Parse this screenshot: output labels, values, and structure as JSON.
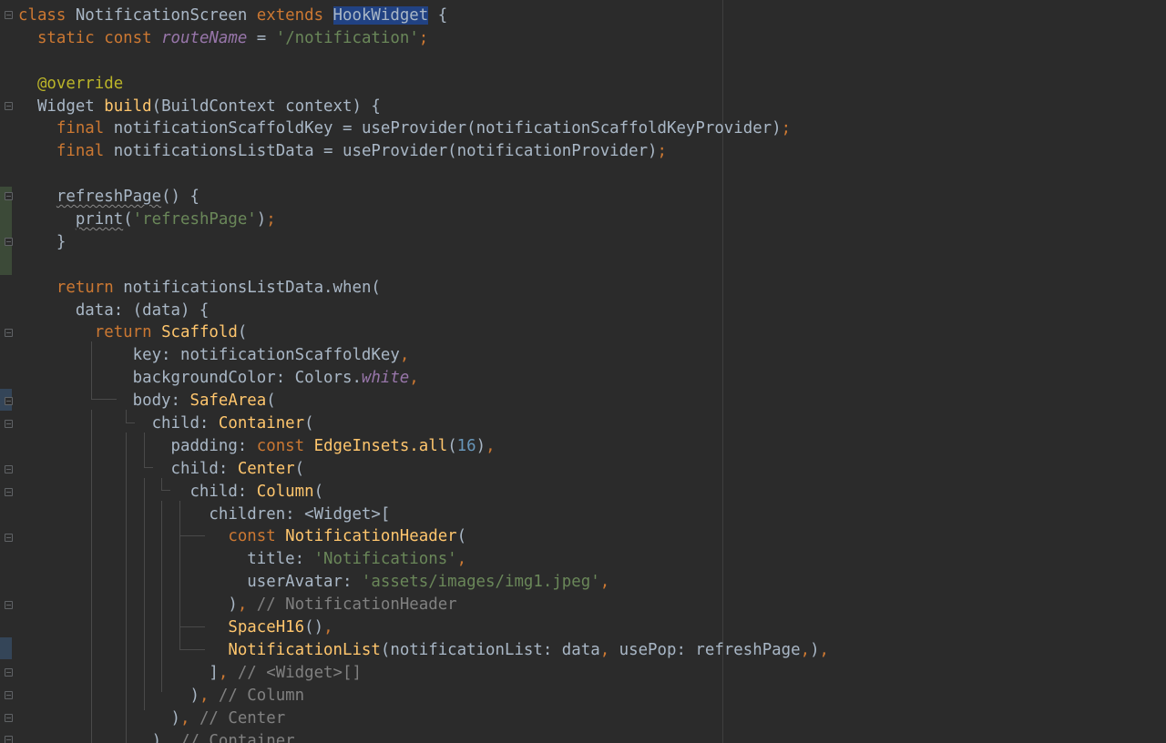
{
  "editor": {
    "language": "dart",
    "lines": [
      [
        [
          "kw",
          "class "
        ],
        [
          "p",
          "NotificationScreen "
        ],
        [
          "kw",
          "extends "
        ],
        [
          "hl",
          "HookWidget"
        ],
        [
          "p",
          " {"
        ]
      ],
      [
        [
          "p",
          "  "
        ],
        [
          "kw",
          "static const "
        ],
        [
          "ital",
          "routeName"
        ],
        [
          "p",
          " = "
        ],
        [
          "str",
          "'/notification'"
        ],
        [
          "kw",
          ";"
        ]
      ],
      [
        [
          "p",
          ""
        ]
      ],
      [
        [
          "p",
          "  "
        ],
        [
          "ann",
          "@override"
        ]
      ],
      [
        [
          "p",
          "  Widget "
        ],
        [
          "fn",
          "build"
        ],
        [
          "p",
          "(BuildContext context) {"
        ]
      ],
      [
        [
          "p",
          "    "
        ],
        [
          "kw",
          "final "
        ],
        [
          "p",
          "notificationScaffoldKey = useProvider(notificationScaffoldKeyProvider)"
        ],
        [
          "kw",
          ";"
        ]
      ],
      [
        [
          "p",
          "    "
        ],
        [
          "kw",
          "final "
        ],
        [
          "p",
          "notificationsListData = useProvider(notificationProvider)"
        ],
        [
          "kw",
          ";"
        ]
      ],
      [
        [
          "p",
          ""
        ]
      ],
      [
        [
          "p",
          "    "
        ],
        [
          "squig",
          "refreshPage"
        ],
        [
          "p",
          "() {"
        ]
      ],
      [
        [
          "p",
          "      "
        ],
        [
          "squig",
          "print"
        ],
        [
          "p",
          "("
        ],
        [
          "str",
          "'refreshPage'"
        ],
        [
          "p",
          ")"
        ],
        [
          "kw",
          ";"
        ]
      ],
      [
        [
          "p",
          "    }"
        ]
      ],
      [
        [
          "p",
          ""
        ]
      ],
      [
        [
          "p",
          "    "
        ],
        [
          "kw",
          "return "
        ],
        [
          "p",
          "notificationsListData.when("
        ]
      ],
      [
        [
          "p",
          "      data: (data) {"
        ]
      ],
      [
        [
          "p",
          "        "
        ],
        [
          "kw",
          "return "
        ],
        [
          "fn",
          "Scaffold"
        ],
        [
          "p",
          "("
        ]
      ],
      [
        [
          "p",
          "            key: notificationScaffoldKey"
        ],
        [
          "kw",
          ","
        ]
      ],
      [
        [
          "p",
          "            backgroundColor: Colors."
        ],
        [
          "ital",
          "white"
        ],
        [
          "kw",
          ","
        ]
      ],
      [
        [
          "p",
          "            body: "
        ],
        [
          "fn",
          "SafeArea"
        ],
        [
          "p",
          "("
        ]
      ],
      [
        [
          "p",
          "              child: "
        ],
        [
          "fn",
          "Container"
        ],
        [
          "p",
          "("
        ]
      ],
      [
        [
          "p",
          "                padding: "
        ],
        [
          "kw",
          "const "
        ],
        [
          "fn",
          "EdgeInsets.all"
        ],
        [
          "p",
          "("
        ],
        [
          "num",
          "16"
        ],
        [
          "p",
          ")"
        ],
        [
          "kw",
          ","
        ]
      ],
      [
        [
          "p",
          "                child: "
        ],
        [
          "fn",
          "Center"
        ],
        [
          "p",
          "("
        ]
      ],
      [
        [
          "p",
          "                  child: "
        ],
        [
          "fn",
          "Column"
        ],
        [
          "p",
          "("
        ]
      ],
      [
        [
          "p",
          "                    children: <Widget>["
        ]
      ],
      [
        [
          "p",
          "                      "
        ],
        [
          "kw",
          "const "
        ],
        [
          "fn",
          "NotificationHeader"
        ],
        [
          "p",
          "("
        ]
      ],
      [
        [
          "p",
          "                        title: "
        ],
        [
          "str",
          "'Notifications'"
        ],
        [
          "kw",
          ","
        ]
      ],
      [
        [
          "p",
          "                        userAvatar: "
        ],
        [
          "str",
          "'assets/images/img1.jpeg'"
        ],
        [
          "kw",
          ","
        ]
      ],
      [
        [
          "p",
          "                      )"
        ],
        [
          "kw",
          ", "
        ],
        [
          "cmt",
          "// NotificationHeader"
        ]
      ],
      [
        [
          "p",
          "                      "
        ],
        [
          "fn",
          "SpaceH16"
        ],
        [
          "p",
          "()"
        ],
        [
          "kw",
          ","
        ]
      ],
      [
        [
          "p",
          "                      "
        ],
        [
          "fn",
          "NotificationList"
        ],
        [
          "p",
          "(notificationList: data"
        ],
        [
          "kw",
          ", "
        ],
        [
          "p",
          "usePop: refreshPage"
        ],
        [
          "kw",
          ","
        ],
        [
          "p",
          ")"
        ],
        [
          "kw",
          ","
        ]
      ],
      [
        [
          "p",
          "                    ]"
        ],
        [
          "kw",
          ", "
        ],
        [
          "cmt",
          "// <Widget>[]"
        ]
      ],
      [
        [
          "p",
          "                  )"
        ],
        [
          "kw",
          ", "
        ],
        [
          "cmt",
          "// Column"
        ]
      ],
      [
        [
          "p",
          "                )"
        ],
        [
          "kw",
          ", "
        ],
        [
          "cmt",
          "// Center"
        ]
      ],
      [
        [
          "p",
          "              )"
        ],
        [
          "kw",
          ", "
        ],
        [
          "cmt",
          "// Container"
        ]
      ]
    ]
  }
}
